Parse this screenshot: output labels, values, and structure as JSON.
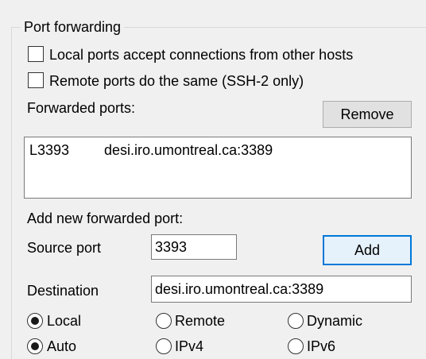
{
  "group": {
    "title": "Port forwarding"
  },
  "options": {
    "local_accept_label": "Local ports accept connections from other hosts",
    "remote_same_label": "Remote ports do the same (SSH-2 only)"
  },
  "forwarded": {
    "label": "Forwarded ports:",
    "remove_label": "Remove",
    "items": [
      {
        "port": "L3393",
        "destination": "desi.iro.umontreal.ca:3389"
      }
    ]
  },
  "add_new": {
    "label": "Add new forwarded port:",
    "source_label": "Source port",
    "source_value": "3393",
    "add_label": "Add",
    "destination_label": "Destination",
    "destination_value": "desi.iro.umontreal.ca:3389"
  },
  "direction": {
    "local": "Local",
    "remote": "Remote",
    "dynamic": "Dynamic",
    "selected": "Local"
  },
  "protocol": {
    "auto": "Auto",
    "ipv4": "IPv4",
    "ipv6": "IPv6",
    "selected": "Auto"
  }
}
